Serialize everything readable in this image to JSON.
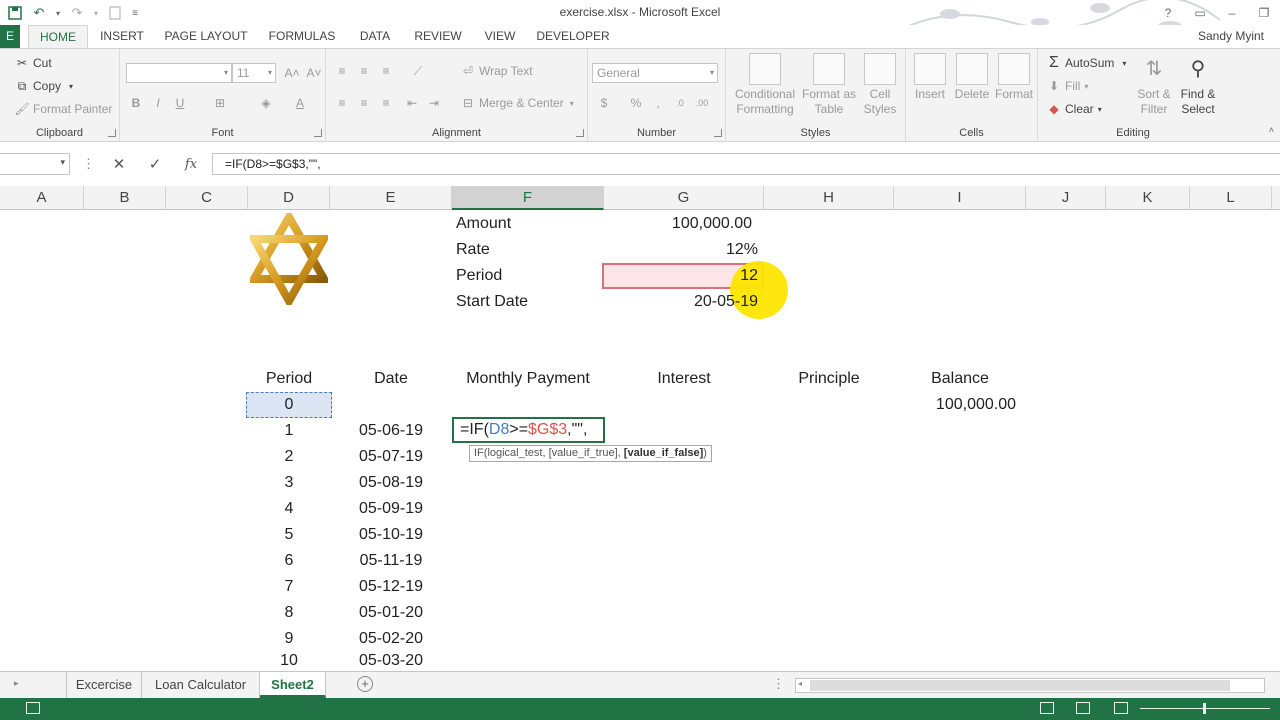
{
  "titlebar": {
    "title": "exercise.xlsx - Microsoft Excel",
    "user": "Sandy Myint"
  },
  "tabs": [
    {
      "id": "file",
      "label": "E"
    },
    {
      "id": "home",
      "label": "HOME"
    },
    {
      "id": "insert",
      "label": "INSERT"
    },
    {
      "id": "page_layout",
      "label": "PAGE LAYOUT"
    },
    {
      "id": "formulas",
      "label": "FORMULAS"
    },
    {
      "id": "data",
      "label": "DATA"
    },
    {
      "id": "review",
      "label": "REVIEW"
    },
    {
      "id": "view",
      "label": "VIEW"
    },
    {
      "id": "developer",
      "label": "DEVELOPER"
    }
  ],
  "ribbon": {
    "clipboard": {
      "label": "Clipboard",
      "cut": "Cut",
      "copy": "Copy",
      "format_painter": "Format Painter"
    },
    "font": {
      "label": "Font",
      "size": "11",
      "bold": "B",
      "italic": "I",
      "underline": "U"
    },
    "alignment": {
      "label": "Alignment",
      "wrap_text": "Wrap Text",
      "merge_center": "Merge & Center"
    },
    "number": {
      "label": "Number",
      "format": "General",
      "currency": "$",
      "percent": "%",
      "comma": ","
    },
    "styles": {
      "label": "Styles",
      "conditional_1": "Conditional",
      "conditional_2": "Formatting",
      "format_as_1": "Format as",
      "format_as_2": "Table",
      "cell_styles_1": "Cell",
      "cell_styles_2": "Styles"
    },
    "cells": {
      "label": "Cells",
      "insert": "Insert",
      "delete": "Delete",
      "format": "Format"
    },
    "editing": {
      "label": "Editing",
      "autosum": "AutoSum",
      "fill": "Fill",
      "clear": "Clear",
      "sort_1": "Sort &",
      "sort_2": "Filter",
      "find_1": "Find &",
      "find_2": "Select"
    }
  },
  "formula_bar": {
    "name_box": "",
    "cancel": "✕",
    "enter": "✓",
    "fx": "fx",
    "formula": "=IF(D8>=$G$3,\"\","
  },
  "columns": [
    "A",
    "B",
    "C",
    "D",
    "E",
    "F",
    "G",
    "H",
    "I",
    "J",
    "K",
    "L"
  ],
  "active_column": "F",
  "sheet": {
    "inputs": [
      {
        "label": "Amount",
        "value": "100,000.00"
      },
      {
        "label": "Rate",
        "value": "12%"
      },
      {
        "label": "Period",
        "value": "12"
      },
      {
        "label": "Start Date",
        "value": "20-05-19"
      }
    ],
    "headers": {
      "period": "Period",
      "date": "Date",
      "payment": "Monthly Payment",
      "interest": "Interest",
      "principle": "Principle",
      "balance": "Balance"
    },
    "row0": {
      "period": "0",
      "balance": "100,000.00"
    },
    "rows": [
      {
        "period": "1",
        "date": "05-06-19"
      },
      {
        "period": "2",
        "date": "05-07-19"
      },
      {
        "period": "3",
        "date": "05-08-19"
      },
      {
        "period": "4",
        "date": "05-09-19"
      },
      {
        "period": "5",
        "date": "05-10-19"
      },
      {
        "period": "6",
        "date": "05-11-19"
      },
      {
        "period": "7",
        "date": "05-12-19"
      },
      {
        "period": "8",
        "date": "05-01-20"
      },
      {
        "period": "9",
        "date": "05-02-20"
      },
      {
        "period": "10",
        "date": "05-03-20"
      }
    ],
    "edit_formula": {
      "prefix": "=IF(",
      "ref1": "D8",
      "op": ">=",
      "ref2": "$G$3",
      "suffix": ",\"\","
    },
    "tooltip": {
      "fn": "IF(logical_test, [value_if_true], ",
      "bold": "[value_if_false]",
      "close": ")"
    }
  },
  "sheet_tabs": [
    {
      "label": "Excercise",
      "active": false
    },
    {
      "label": "Loan Calculator",
      "active": false
    },
    {
      "label": "Sheet2",
      "active": true
    }
  ],
  "colors": {
    "accent": "#217346",
    "ref_blue": "#4a7ac6",
    "ref_red": "#d9534f",
    "highlight": "#ffe500"
  }
}
